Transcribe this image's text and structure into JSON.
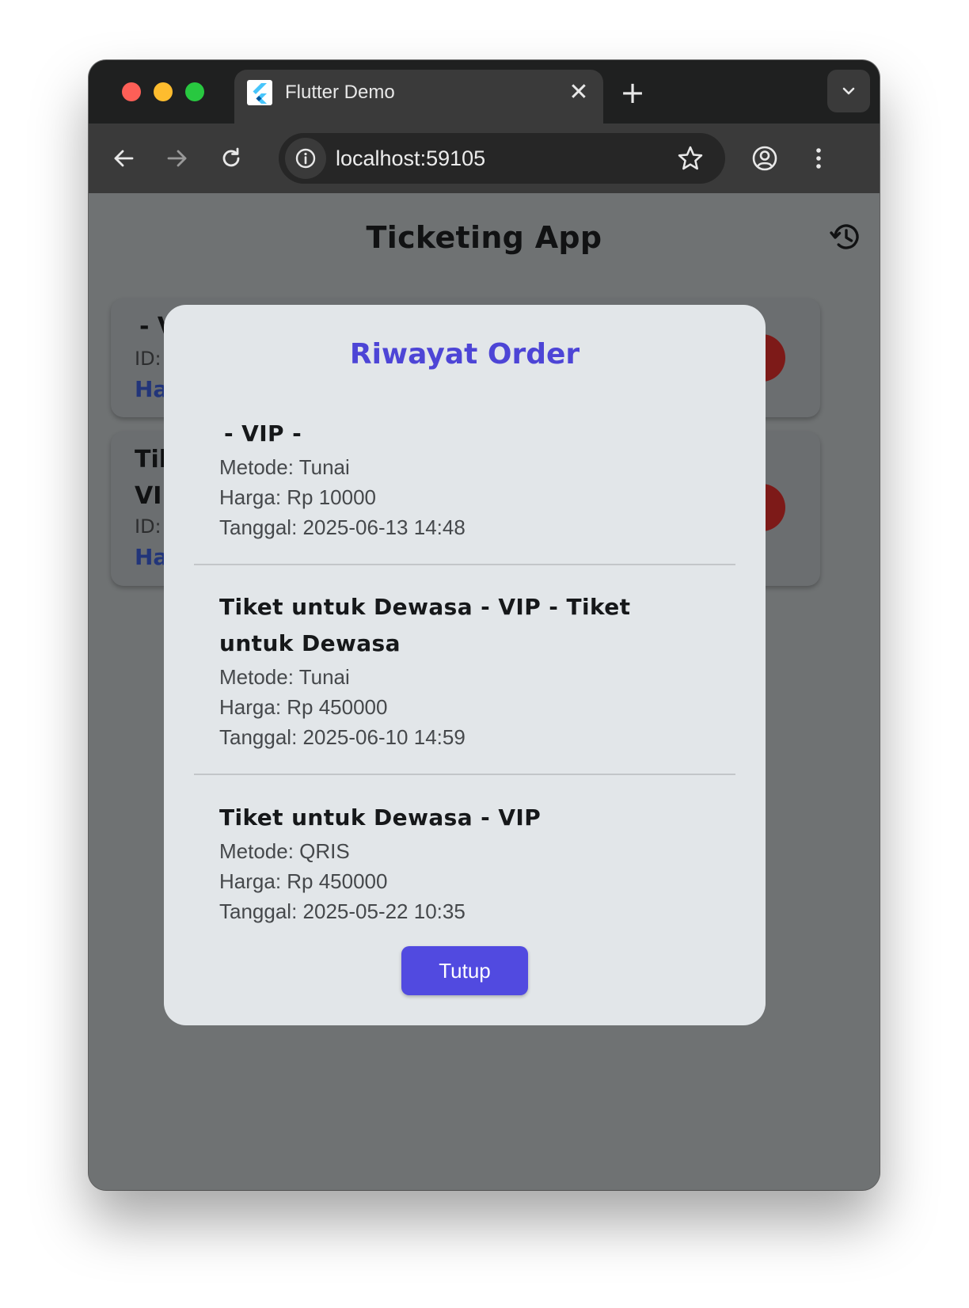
{
  "browser": {
    "tab_title": "Flutter Demo",
    "tab_close_label": "✕",
    "new_tab_label": "+",
    "url": "localhost:59105"
  },
  "app": {
    "title": "Ticketing App"
  },
  "background_cards": [
    {
      "title_fragment": "- V",
      "id_label": "ID:",
      "price_fragment": "Ha"
    },
    {
      "title_fragment_line1": "Tik",
      "title_fragment_line2": "VI",
      "id_label": "ID:",
      "price_fragment": "Ha"
    }
  ],
  "dialog": {
    "title": "Riwayat Order",
    "orders": [
      {
        "title": "- VIP -",
        "method": "Metode: Tunai",
        "price": "Harga: Rp 10000",
        "date": "Tanggal: 2025-06-13 14:48"
      },
      {
        "title_line1": "Tiket untuk Dewasa - VIP - Tiket",
        "title_line2": "untuk Dewasa",
        "method": "Metode: Tunai",
        "price": "Harga: Rp 450000",
        "date": "Tanggal: 2025-06-10 14:59"
      },
      {
        "title": "Tiket untuk Dewasa - VIP",
        "method": "Metode: QRIS",
        "price": "Harga: Rp 450000",
        "date": "Tanggal: 2025-05-22 10:35"
      }
    ],
    "close_label": "Tutup"
  },
  "colors": {
    "accent": "#514ae0",
    "dialog_title": "#4d45d6",
    "scrim": "#6f7273",
    "delete_button": "#7d1a18"
  },
  "icons": {
    "back": "arrow-left-icon",
    "forward": "arrow-right-icon",
    "reload": "reload-icon",
    "info": "info-icon",
    "bookmark": "star-icon",
    "profile": "account-circle-icon",
    "menu": "more-vert-icon",
    "history": "history-icon",
    "tab_search": "chevron-down-icon",
    "favicon": "flutter-logo-icon"
  }
}
